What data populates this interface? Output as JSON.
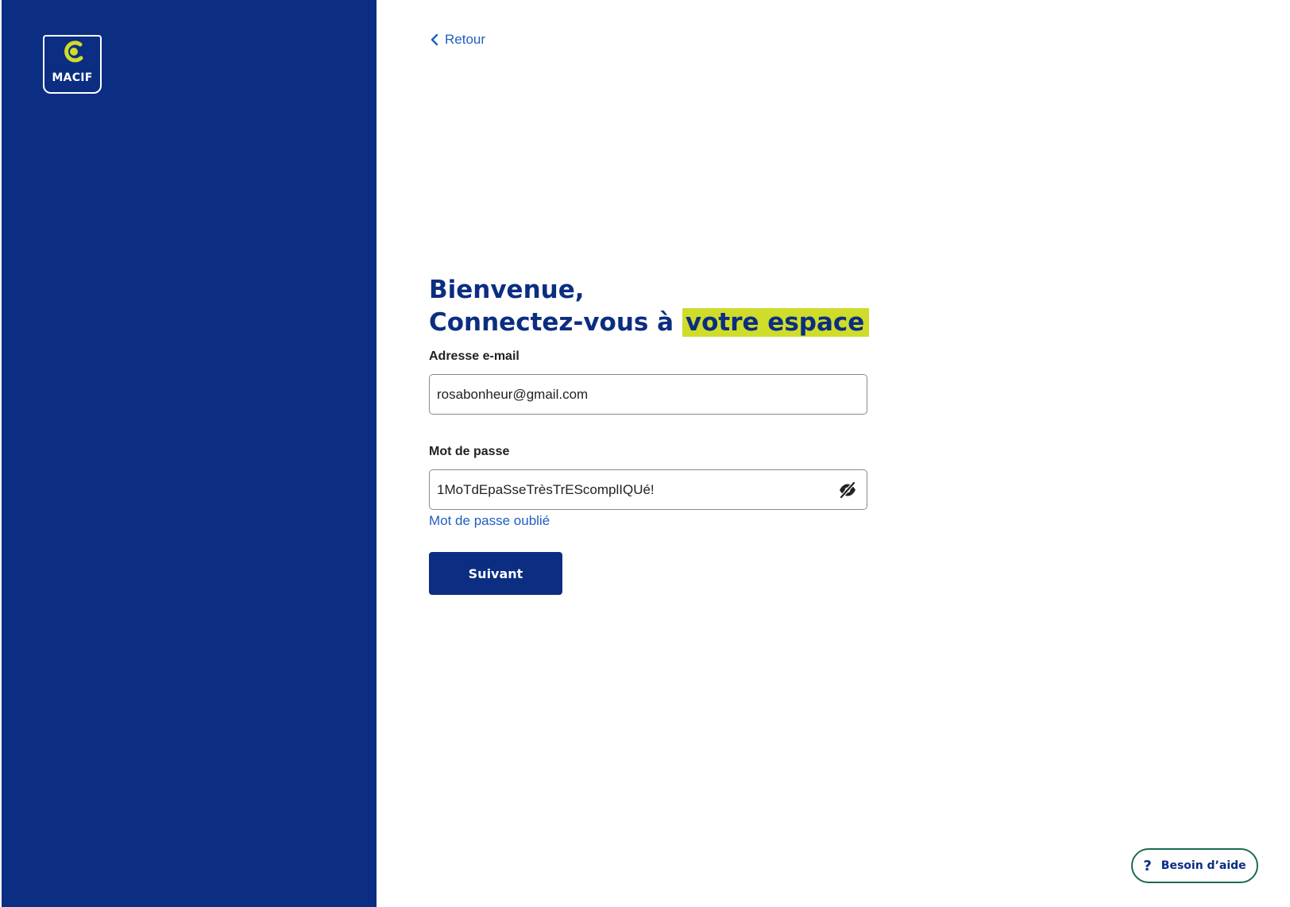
{
  "brand": {
    "logo_text": "MACIF"
  },
  "nav": {
    "back_label": "Retour"
  },
  "login": {
    "title_line1": "Bienvenue,",
    "title_line2_prefix": "Connectez-vous à",
    "title_line2_highlight": "votre espace",
    "email_label": "Adresse e-mail",
    "email_value": "rosabonheur@gmail.com",
    "password_label": "Mot de passe",
    "password_value": "1MoTdEpaSseTrèsTrEScomplIQUé!",
    "forgot_label": "Mot de passe oublié",
    "submit_label": "Suivant"
  },
  "help": {
    "icon_glyph": "?",
    "label": "Besoin d’aide"
  },
  "colors": {
    "primary": "#0b2d82",
    "highlight": "#cfdc2a",
    "link": "#1f5fbf",
    "help_border": "#1b6b4f"
  },
  "icons": {
    "back": "chevron-left-icon",
    "password_toggle": "eye-slash-icon",
    "logo_mark": "macif-logo-icon"
  }
}
